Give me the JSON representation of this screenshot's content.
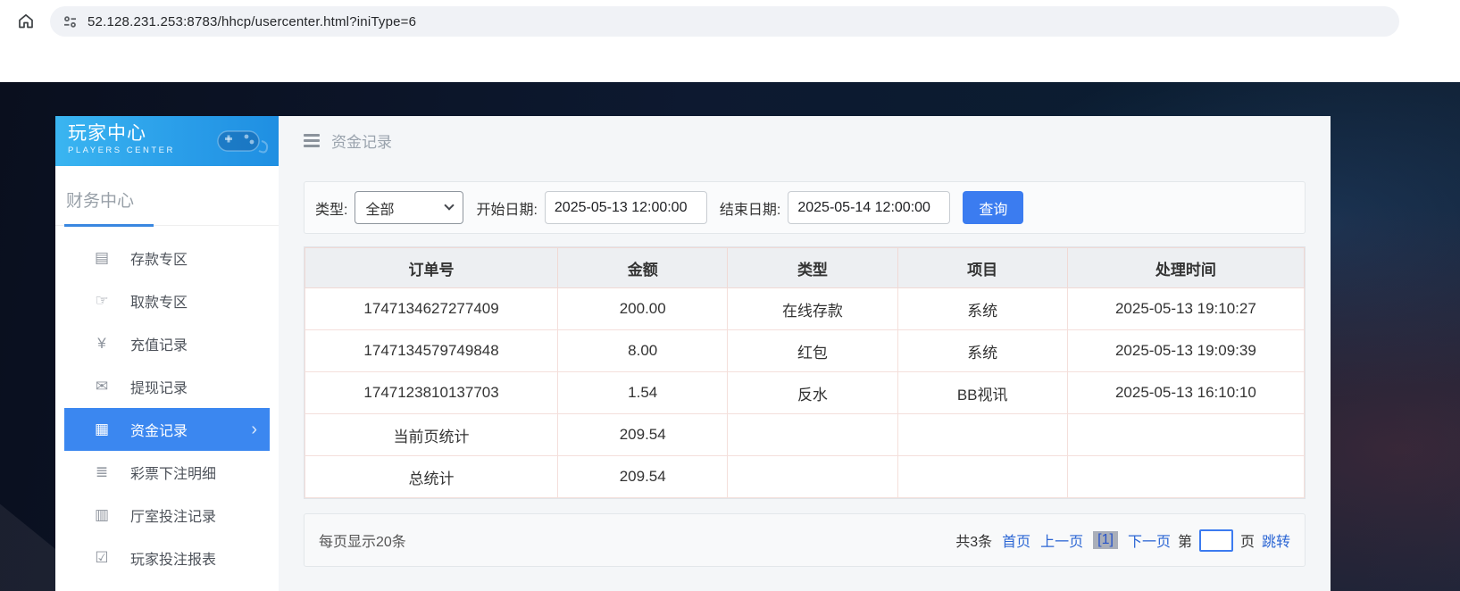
{
  "browser": {
    "url": "52.128.231.253:8783/hhcp/usercenter.html?iniType=6"
  },
  "sidebar": {
    "title": "玩家中心",
    "subtitle": "PLAYERS CENTER",
    "section_title": "财务中心",
    "items": [
      {
        "label": "存款专区",
        "icon": "deposit-card-icon",
        "glyph": "▤",
        "active": false
      },
      {
        "label": "取款专区",
        "icon": "withdraw-hand-icon",
        "glyph": "☞",
        "active": false
      },
      {
        "label": "充值记录",
        "icon": "moneybag-icon",
        "glyph": "¥",
        "active": false
      },
      {
        "label": "提现记录",
        "icon": "wallet-icon",
        "glyph": "✉",
        "active": false
      },
      {
        "label": "资金记录",
        "icon": "fund-records-icon",
        "glyph": "▦",
        "active": true,
        "chevron": "›"
      },
      {
        "label": "彩票下注明细",
        "icon": "lottery-detail-icon",
        "glyph": "≣",
        "active": false
      },
      {
        "label": "厅室投注记录",
        "icon": "hall-bet-icon",
        "glyph": "▥",
        "active": false
      },
      {
        "label": "玩家投注报表",
        "icon": "report-chart-icon",
        "glyph": "☑",
        "active": false
      }
    ]
  },
  "main": {
    "page_title": "资金记录",
    "filters": {
      "type_label": "类型:",
      "type_value": "全部",
      "start_label": "开始日期:",
      "start_value": "2025-05-13 12:00:00",
      "end_label": "结束日期:",
      "end_value": "2025-05-14 12:00:00",
      "query_button": "查询"
    },
    "table": {
      "headers": [
        "订单号",
        "金额",
        "类型",
        "项目",
        "处理时间"
      ],
      "rows": [
        [
          "1747134627277409",
          "200.00",
          "在线存款",
          "系统",
          "2025-05-13 19:10:27"
        ],
        [
          "1747134579749848",
          "8.00",
          "红包",
          "系统",
          "2025-05-13 19:09:39"
        ],
        [
          "1747123810137703",
          "1.54",
          "反水",
          "BB视讯",
          "2025-05-13 16:10:10"
        ],
        [
          "当前页统计",
          "209.54",
          "",
          "",
          ""
        ],
        [
          "总统计",
          "209.54",
          "",
          "",
          ""
        ]
      ]
    },
    "pagination": {
      "page_size_text": "每页显示20条",
      "total_text": "共3条",
      "first": "首页",
      "prev": "上一页",
      "current": "[1]",
      "next": "下一页",
      "jump_prefix": "第",
      "jump_input_value": "",
      "jump_suffix": "页",
      "jump_button": "跳转"
    }
  },
  "colors": {
    "accent_blue": "#3b7cf0",
    "active_item_blue": "#3b87f0",
    "link_blue": "#2c66d4",
    "sidebar_header_gradient_start": "#3ab5f1",
    "sidebar_header_gradient_end": "#1f8fe2",
    "table_border_pink": "#f2dad6",
    "table_header_bg": "#edeff2",
    "current_page_bg": "#a9aeb9"
  }
}
